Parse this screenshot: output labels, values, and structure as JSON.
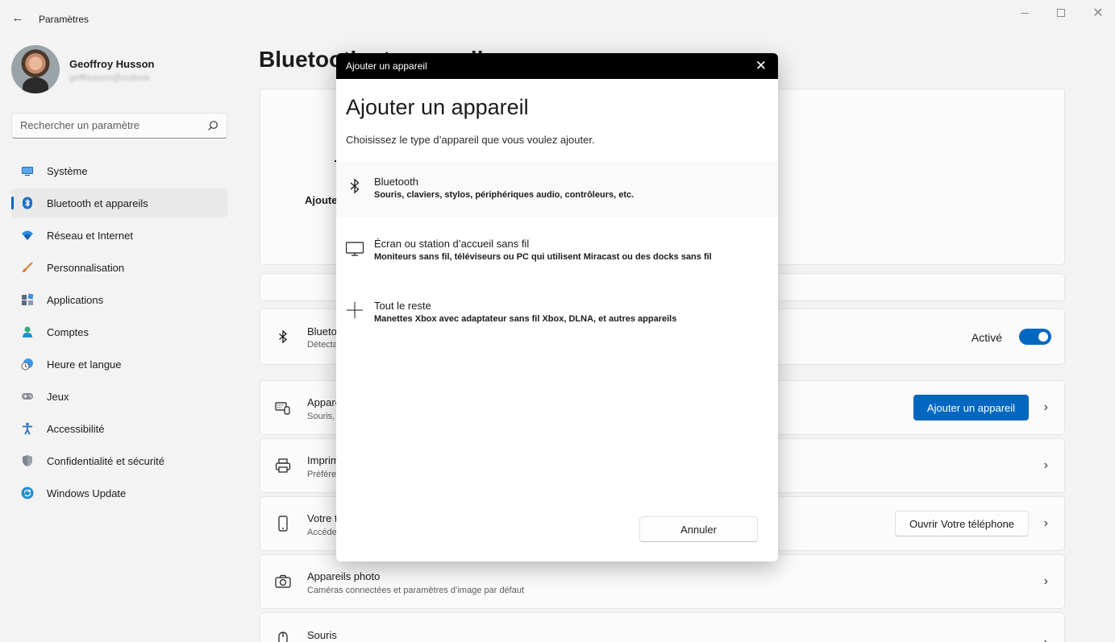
{
  "window": {
    "app_title": "Paramètres",
    "back_glyph": "←",
    "close_glyph": "✕"
  },
  "profile": {
    "name": "Geoffroy Husson",
    "email_blurred": "geffhusson@outlook"
  },
  "search": {
    "placeholder": "Rechercher un paramètre"
  },
  "sidebar": {
    "items": [
      {
        "label": "Système",
        "icon": "monitor-icon"
      },
      {
        "label": "Bluetooth et appareils",
        "icon": "bluetooth-icon",
        "active": true
      },
      {
        "label": "Réseau et Internet",
        "icon": "wifi-icon"
      },
      {
        "label": "Personnalisation",
        "icon": "brush-icon"
      },
      {
        "label": "Applications",
        "icon": "apps-icon"
      },
      {
        "label": "Comptes",
        "icon": "account-icon"
      },
      {
        "label": "Heure et langue",
        "icon": "clock-globe-icon"
      },
      {
        "label": "Jeux",
        "icon": "gamepad-icon"
      },
      {
        "label": "Accessibilité",
        "icon": "accessibility-icon"
      },
      {
        "label": "Confidentialité et sécurité",
        "icon": "shield-icon"
      },
      {
        "label": "Windows Update",
        "icon": "update-icon"
      }
    ]
  },
  "content": {
    "page_title": "Bluetooth et appareils",
    "top_card_partial": "Ajoute",
    "bluetooth_row": {
      "title": "Bluetooth",
      "subtitle": "Détectable",
      "state_label": "Activé"
    },
    "devices_row": {
      "title": "Appareils",
      "subtitle": "Souris, claviers, stylos",
      "button": "Ajouter un appareil"
    },
    "printers_row": {
      "title": "Imprimantes et scanners",
      "subtitle": "Préférences"
    },
    "phone_row": {
      "title": "Votre téléphone",
      "subtitle": "Accéder",
      "button": "Ouvrir Votre téléphone"
    },
    "camera_row": {
      "title": "Appareils photo",
      "subtitle": "Caméras connectées et paramètres d’image par défaut"
    },
    "mouse_row": {
      "title": "Souris"
    },
    "chevron_glyph": "›"
  },
  "dialog": {
    "titlebar": "Ajouter un appareil",
    "heading": "Ajouter un appareil",
    "subtitle": "Choisissez le type d’appareil que vous voulez ajouter.",
    "options": [
      {
        "title": "Bluetooth",
        "desc": "Souris, claviers, stylos, périphériques audio, contrôleurs, etc.",
        "icon": "bluetooth-icon"
      },
      {
        "title": "Écran ou station d’accueil sans fil",
        "desc": "Moniteurs sans fil, téléviseurs ou PC qui utilisent Miracast ou des docks sans fil",
        "icon": "monitor-icon"
      },
      {
        "title": "Tout le reste",
        "desc": "Manettes Xbox avec adaptateur sans fil Xbox, DLNA, et autres appareils",
        "icon": "plus-icon"
      }
    ],
    "cancel": "Annuler"
  },
  "colors": {
    "accent": "#0067c0",
    "background": "#f3f3f3",
    "card": "#fbfbfb",
    "dialog_titlebar": "#000000"
  }
}
